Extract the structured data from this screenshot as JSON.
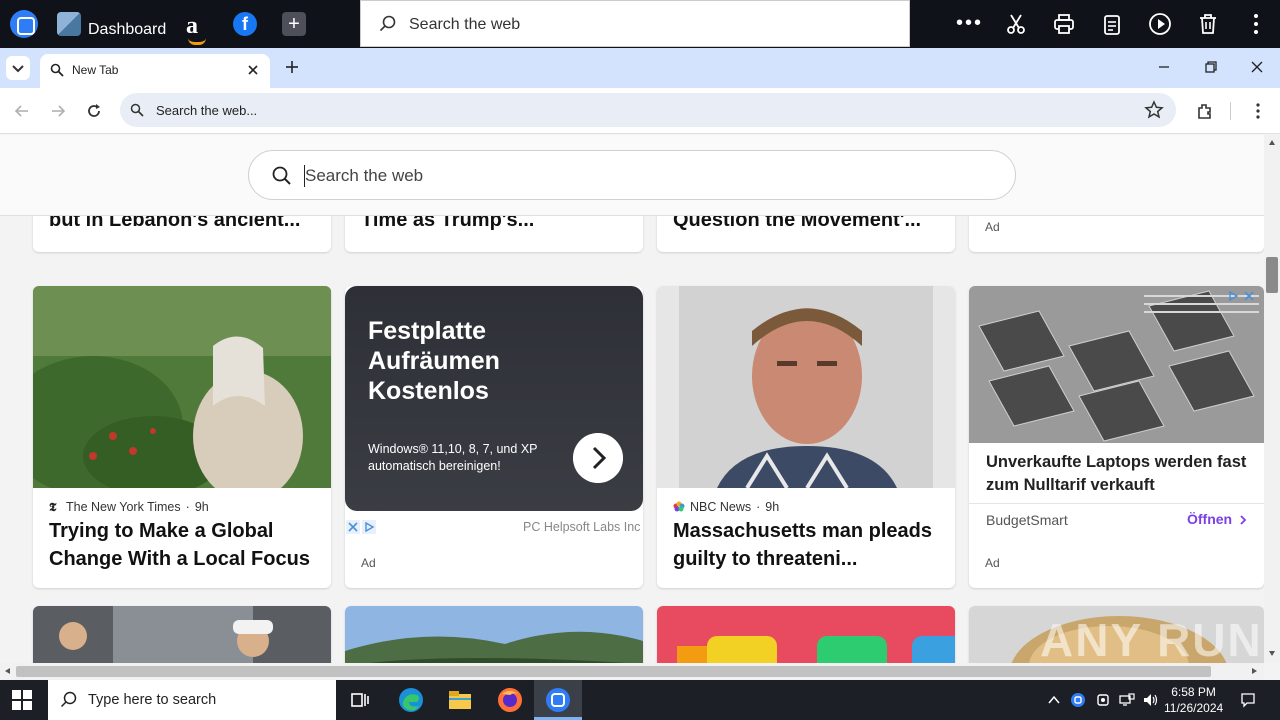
{
  "toolbar": {
    "dashboard_label": "Dashboard",
    "amazon_glyph": "a",
    "facebook_glyph": "f",
    "add_glyph": "+",
    "search_placeholder": "Search the web",
    "more_glyph": "•••"
  },
  "tabs": [
    {
      "title": "New Tab",
      "active": true
    }
  ],
  "address_bar": {
    "text": "Search the web..."
  },
  "page_search": {
    "placeholder": "Search the web"
  },
  "top_row_cards": [
    {
      "title": "but in Lebanon's ancient..."
    },
    {
      "title": "Time as Trump's..."
    },
    {
      "title": "Question the Movement'..."
    },
    {
      "ad_label": "Ad"
    }
  ],
  "cards": [
    {
      "source": "The New York Times",
      "age": "9h",
      "headline": "Trying to Make a Global Change With a Local Focus"
    },
    {
      "promo_title": "Festplatte Aufräumen Kostenlos",
      "promo_sub": "Windows® 11,10, 8, 7, und XP automatisch bereinigen!",
      "advertiser": "PC Helpsoft Labs Inc",
      "ad_label": "Ad"
    },
    {
      "source": "NBC News",
      "age": "9h",
      "headline": "Massachusetts man pleads guilty to threateni..."
    },
    {
      "headline": "Unverkaufte Laptops werden fast zum Nulltarif verkauft",
      "brand": "BudgetSmart",
      "cta": "Öffnen",
      "ad_label": "Ad"
    }
  ],
  "watermark": "ANY RUN",
  "taskbar": {
    "search_placeholder": "Type here to search",
    "time": "6:58 PM",
    "date": "11/26/2024"
  },
  "colors": {
    "tabstrip": "#d3e3fd",
    "toolbar": "#0f1218",
    "accent_cta": "#7b3fe4",
    "taskbar": "#1c1f26"
  }
}
